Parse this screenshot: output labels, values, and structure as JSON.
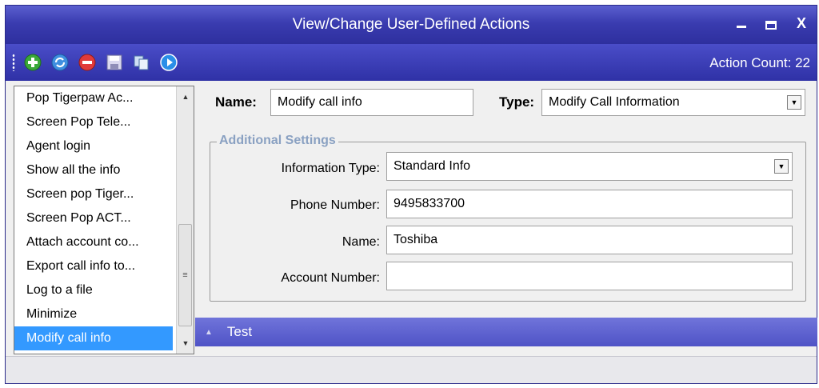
{
  "window": {
    "title": "View/Change User-Defined Actions",
    "controls": [
      "minimize-icon",
      "maximize-icon",
      "close-icon"
    ],
    "close_label": "X"
  },
  "toolbar": {
    "icons": [
      "add-action-icon",
      "refresh-icon",
      "delete-action-icon",
      "save-icon",
      "copy-icon",
      "play-icon"
    ],
    "action_count_label": "Action Count: 22"
  },
  "actions_list": {
    "items": [
      "Pop Tigerpaw Ac...",
      "Screen Pop Tele...",
      "Agent login",
      "Show all the info",
      "Screen pop Tiger...",
      "Screen Pop ACT...",
      "Attach account co...",
      "Export call info to...",
      "Log to a file",
      "Minimize",
      "Modify call info"
    ],
    "selected_index": 10
  },
  "form": {
    "name_label": "Name:",
    "name_value": "Modify call info",
    "type_label": "Type:",
    "type_value": "Modify Call Information"
  },
  "additional_settings": {
    "title": "Additional Settings",
    "information_type_label": "Information Type:",
    "information_type_value": "Standard Info",
    "phone_number_label": "Phone Number:",
    "phone_number_value": "9495833700",
    "name_label": "Name:",
    "name_value": "Toshiba",
    "account_number_label": "Account Number:",
    "account_number_value": ""
  },
  "test_panel": {
    "label": "Test"
  },
  "colors": {
    "title_bar": "#3a3cb0",
    "toolbar": "#2f31a6",
    "selection": "#3399ff",
    "test_bar": "#5f63d0",
    "group_title": "#8aa1c2"
  }
}
